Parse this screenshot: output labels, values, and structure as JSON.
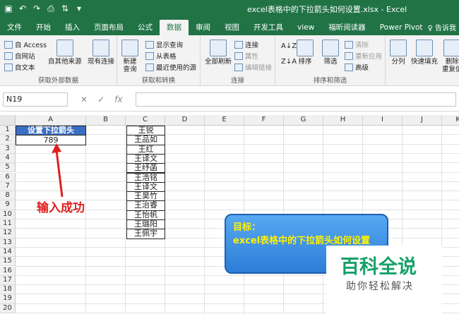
{
  "window": {
    "title": "excel表格中的下拉箭头如何设置.xlsx  -  Excel",
    "qat": [
      "save-icon",
      "undo-icon",
      "redo-icon",
      "print-preview-icon",
      "sort-icon",
      "customize-icon"
    ]
  },
  "tabs": [
    "文件",
    "开始",
    "插入",
    "页面布局",
    "公式",
    "数据",
    "审阅",
    "视图",
    "开发工具",
    "view",
    "福昕阅读器",
    "Power Pivot"
  ],
  "active_tab": "数据",
  "tell_me": "♀ 告诉我",
  "ribbon": {
    "get_external": {
      "label": "获取外部数据",
      "access": "自 Access",
      "web": "自网站",
      "text": "自文本",
      "other": "自其他来源",
      "existing": "现有连接"
    },
    "get_transform": {
      "label": "获取和转换",
      "new_query": "新建\n查询",
      "show_queries": "显示查询",
      "from_table": "从表格",
      "recent_sources": "最近使用的源"
    },
    "connections": {
      "label": "连接",
      "refresh_all": "全部刷新",
      "connections": "连接",
      "properties": "属性",
      "edit_links": "编辑链接"
    },
    "sort_filter": {
      "label": "排序和筛选",
      "sort": "排序",
      "filter": "筛选",
      "clear": "清除",
      "reapply": "重新应用",
      "advanced": "高级"
    },
    "data_tools": {
      "text_to_columns": "分列",
      "flash_fill": "快速填充",
      "remove_dup": "删除\n重复值"
    }
  },
  "formula_bar": {
    "name_box": "N19",
    "cancel": "✕",
    "enter": "✓",
    "fx": "fx",
    "value": ""
  },
  "columns": [
    "A",
    "B",
    "C",
    "D",
    "E",
    "F",
    "G",
    "H",
    "I",
    "J",
    "K"
  ],
  "rows": [
    "1",
    "2",
    "3",
    "4",
    "5",
    "6",
    "7",
    "8",
    "9",
    "10",
    "11",
    "12",
    "13",
    "14",
    "15",
    "16",
    "17",
    "18",
    "19",
    "20"
  ],
  "sheet": {
    "a1": "设置下拉箭头",
    "a2": "789",
    "names": [
      "王锐",
      "王品如",
      "王红",
      "王译文",
      "王纾菡",
      "王浩铭",
      "王译文",
      "王昊竹",
      "王治睿",
      "王怡帆",
      "王璐阳",
      "王佩宇"
    ],
    "success_text": "输入成功",
    "callout_title": "目标：",
    "callout_body": "excel表格中的下拉箭头如何设置"
  },
  "watermark": {
    "title": "百科全说",
    "subtitle": "助你轻松解决"
  },
  "colors": {
    "excel_green": "#217346",
    "header_fill": "#3a6fc4",
    "success_red": "#e02020",
    "callout_text": "#fff200",
    "watermark_green": "#16a06a"
  }
}
